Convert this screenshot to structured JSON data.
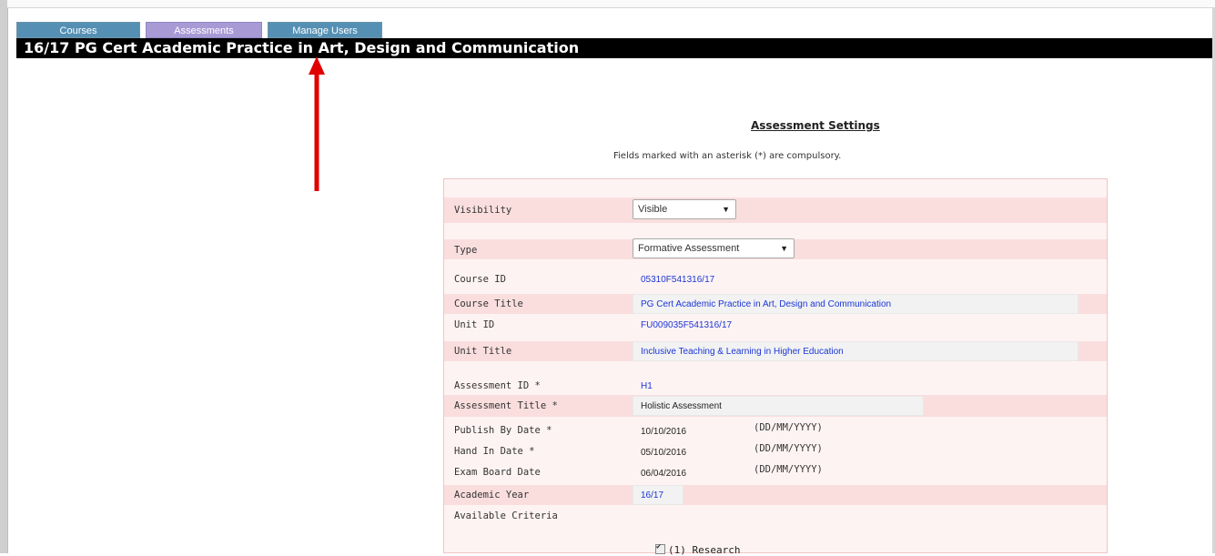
{
  "tabs": {
    "courses": "Courses",
    "assessments": "Assessments",
    "manage_users": "Manage Users"
  },
  "page_title": "16/17 PG Cert Academic Practice in Art, Design and Communication",
  "settings": {
    "heading": "Assessment Settings",
    "note": "Fields marked with an asterisk (*) are compulsory.",
    "visibility": {
      "label": "Visibility",
      "value": "Visible"
    },
    "type": {
      "label": "Type",
      "value": "Formative Assessment"
    },
    "course_id": {
      "label": "Course ID",
      "value": "05310F541316/17"
    },
    "course_title": {
      "label": "Course Title",
      "value": "PG Cert Academic Practice in Art, Design and Communication"
    },
    "unit_id": {
      "label": "Unit ID",
      "value": "FU009035F541316/17"
    },
    "unit_title": {
      "label": "Unit Title",
      "value": "Inclusive Teaching & Learning in Higher Education"
    },
    "assessment_id": {
      "label": "Assessment ID *",
      "value": "H1"
    },
    "assessment_title": {
      "label": "Assessment Title *",
      "value": "Holistic Assessment"
    },
    "publish_by_date": {
      "label": "Publish By Date *",
      "value": "10/10/2016",
      "format": "(DD/MM/YYYY)"
    },
    "hand_in_date": {
      "label": "Hand In Date *",
      "value": "05/10/2016",
      "format": "(DD/MM/YYYY)"
    },
    "exam_board_date": {
      "label": "Exam Board Date",
      "value": "06/04/2016",
      "format": "(DD/MM/YYYY)"
    },
    "academic_year": {
      "label": "Academic Year",
      "value": "16/17"
    },
    "available_criteria": {
      "label": "Available Criteria"
    },
    "criteria": [
      {
        "label": "(1) Research",
        "checked": true
      }
    ]
  },
  "annotation": {
    "arrow_color": "#e00000"
  }
}
